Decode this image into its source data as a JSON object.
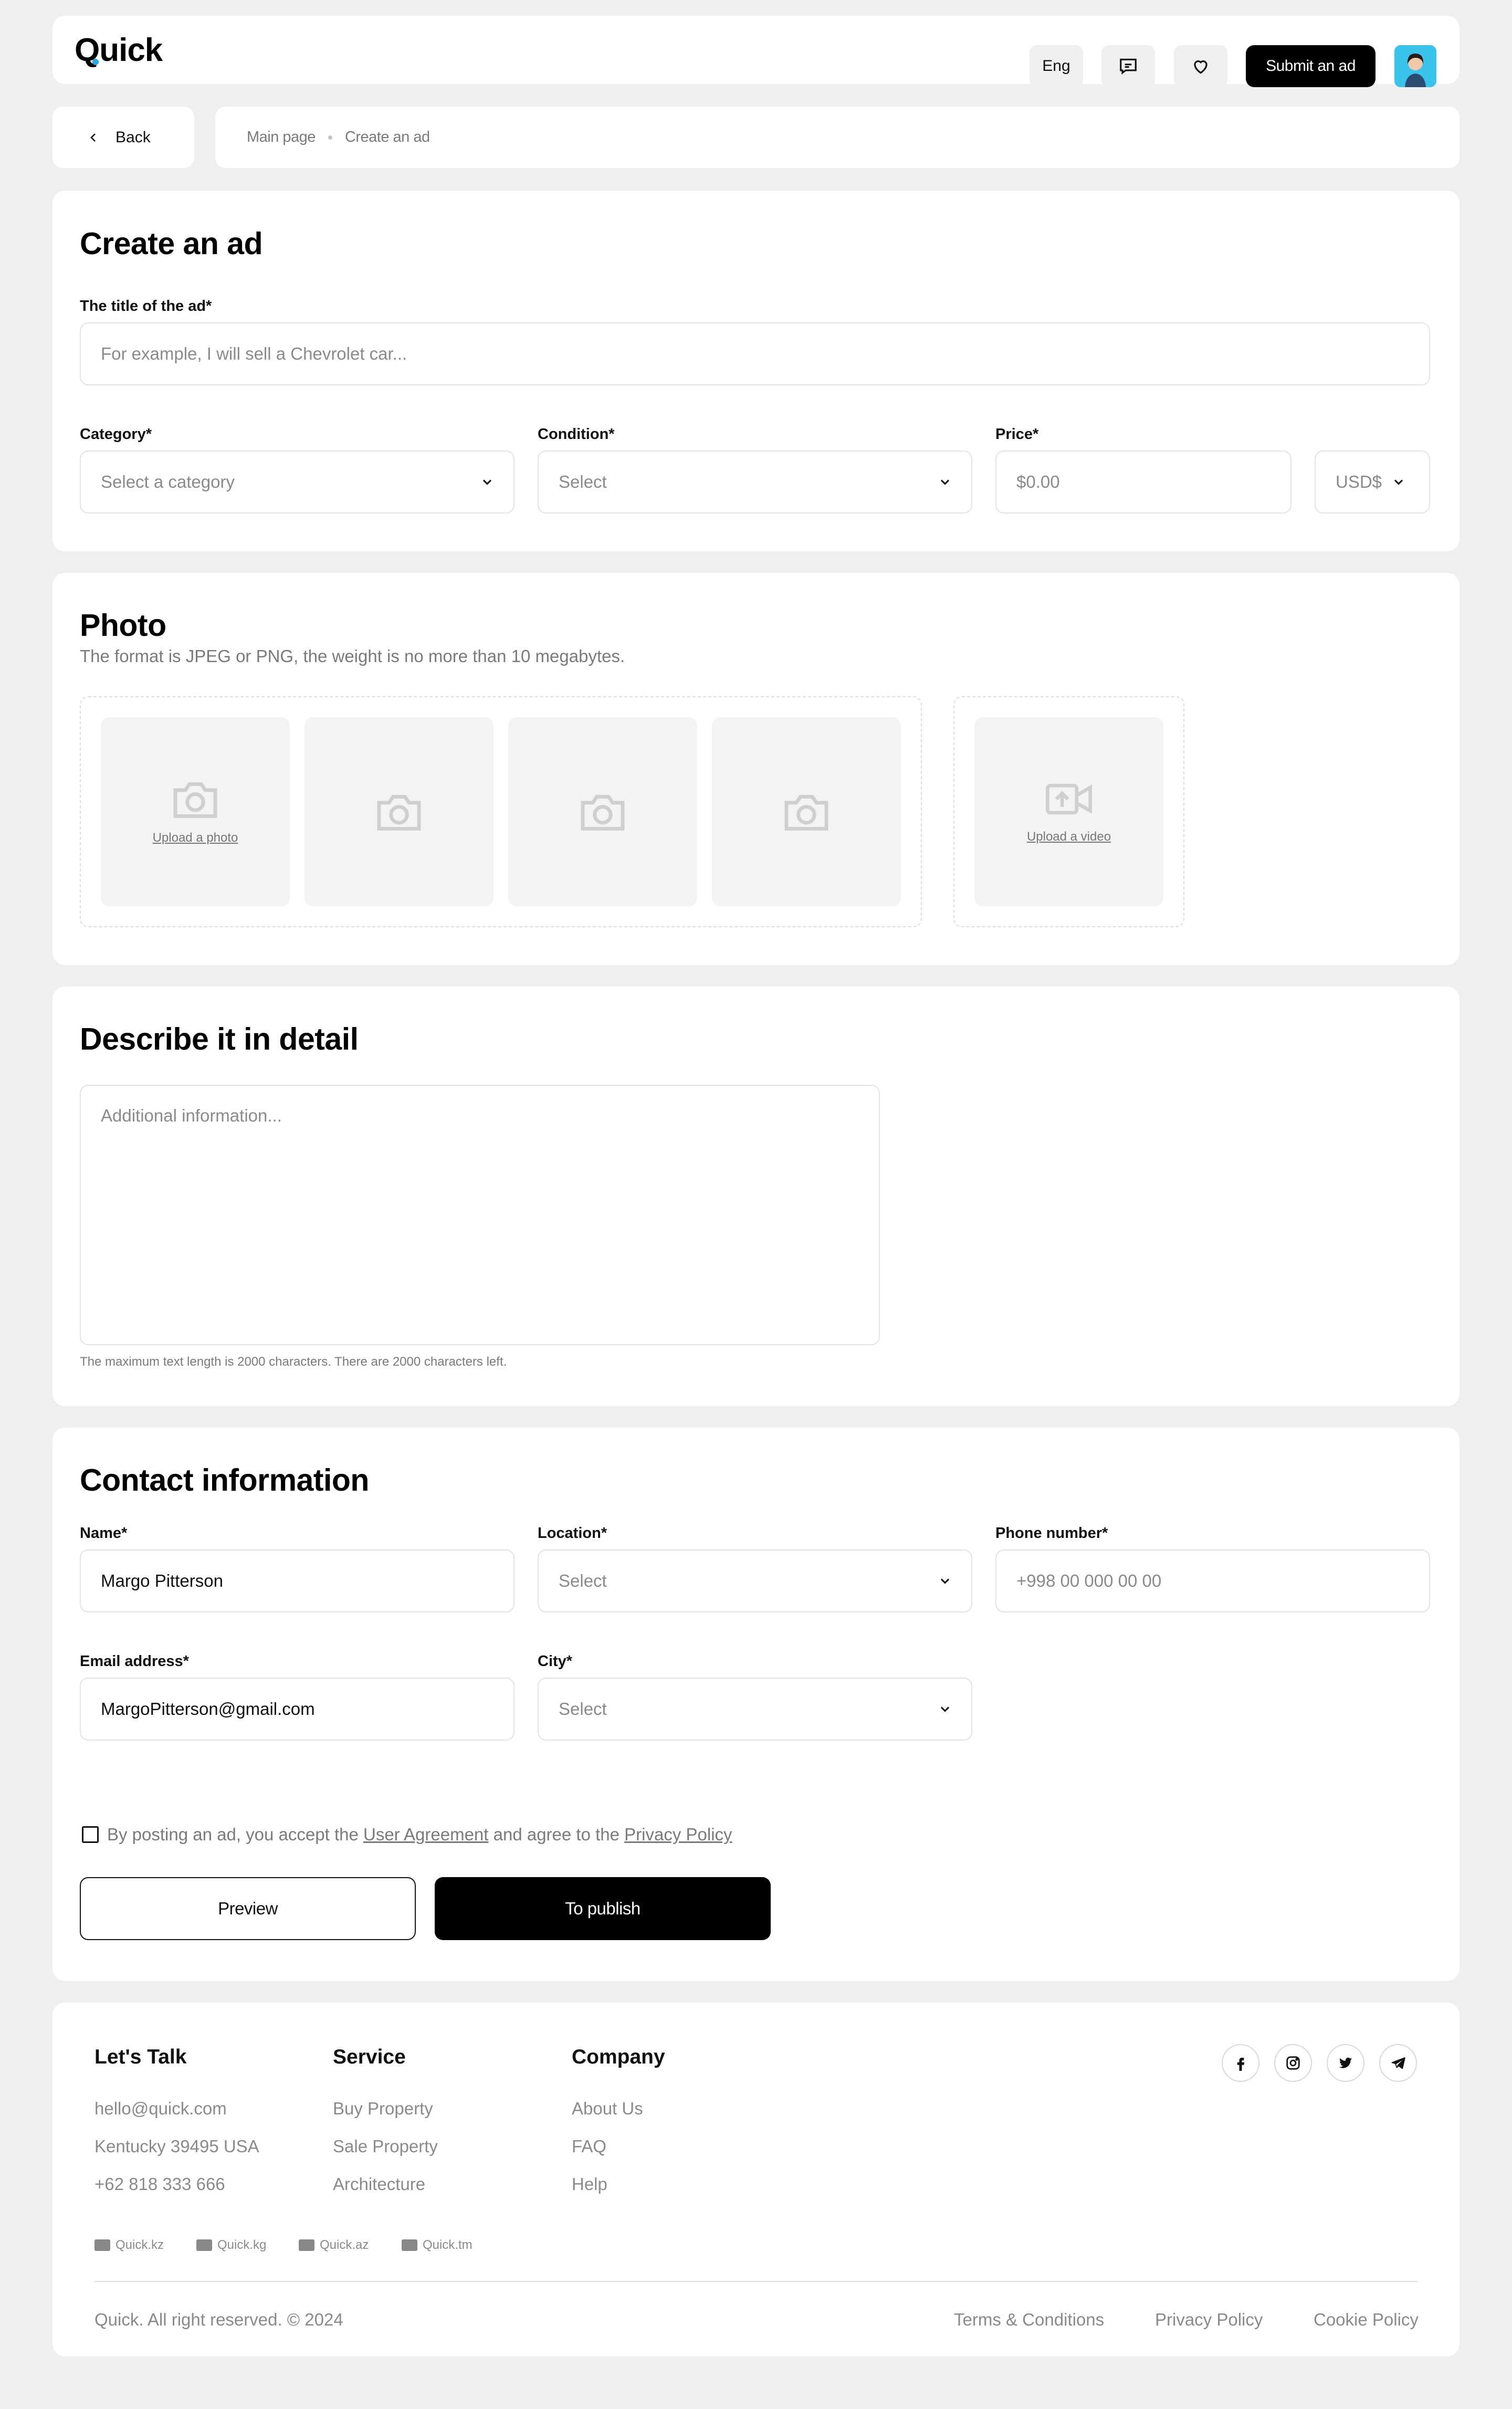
{
  "header": {
    "logo": "Quick",
    "lang": "Eng",
    "submit_label": "Submit an ad"
  },
  "nav": {
    "back_label": "Back",
    "breadcrumb": [
      "Main page",
      "Create an ad"
    ]
  },
  "create": {
    "title": "Create an ad",
    "ad_title_label": "The title of the ad*",
    "ad_title_placeholder": "For example, I will sell a Chevrolet car...",
    "category_label": "Category*",
    "category_value": "Select a category",
    "condition_label": "Condition*",
    "condition_value": "Select",
    "price_label": "Price*",
    "price_placeholder": "$0.00",
    "currency_value": "USD$"
  },
  "photo": {
    "title": "Photo",
    "subtitle": "The format is JPEG or PNG, the weight is no more than 10 megabytes.",
    "upload_photo": "Upload a photo",
    "upload_video": "Upload a video"
  },
  "describe": {
    "title": "Describe it in detail",
    "placeholder": "Additional information...",
    "hint": "The maximum text length is 2000 characters. There are 2000 characters left."
  },
  "contact": {
    "title": "Contact information",
    "name_label": "Name*",
    "name_value": "Margo Pitterson",
    "location_label": "Location*",
    "location_value": "Select",
    "phone_label": "Phone number*",
    "phone_placeholder": "+998 00 000 00 00",
    "email_label": "Email address*",
    "email_value": "MargoPitterson@gmail.com",
    "city_label": "City*",
    "city_value": "Select",
    "agree_prefix": "By posting an ad, you accept the ",
    "agree_link1": "User Agreement",
    "agree_mid": " and agree to the ",
    "agree_link2": "Privacy Policy",
    "preview_label": "Preview",
    "publish_label": "To publish"
  },
  "footer": {
    "col1": {
      "title": "Let's Talk",
      "items": [
        "hello@quick.com",
        "Kentucky 39495 USA",
        "+62 818 333 666"
      ]
    },
    "col2": {
      "title": "Service",
      "items": [
        "Buy Property",
        "Sale Property",
        "Architecture"
      ]
    },
    "col3": {
      "title": "Company",
      "items": [
        "About Us",
        "FAQ",
        "Help"
      ]
    },
    "domains": [
      "Quick.kz",
      "Quick.kg",
      "Quick.az",
      "Quick.tm"
    ],
    "copyright": "Quick. All right reserved. © 2024",
    "legal": [
      "Terms & Conditions",
      "Privacy Policy",
      "Cookie Policy"
    ],
    "socials": [
      "facebook-icon",
      "instagram-icon",
      "twitter-icon",
      "telegram-icon"
    ]
  },
  "colors": {
    "accent": "#000000",
    "page_bg": "#efefef",
    "muted": "#8a8a8a",
    "logo_dot": "#2aa6e0"
  }
}
